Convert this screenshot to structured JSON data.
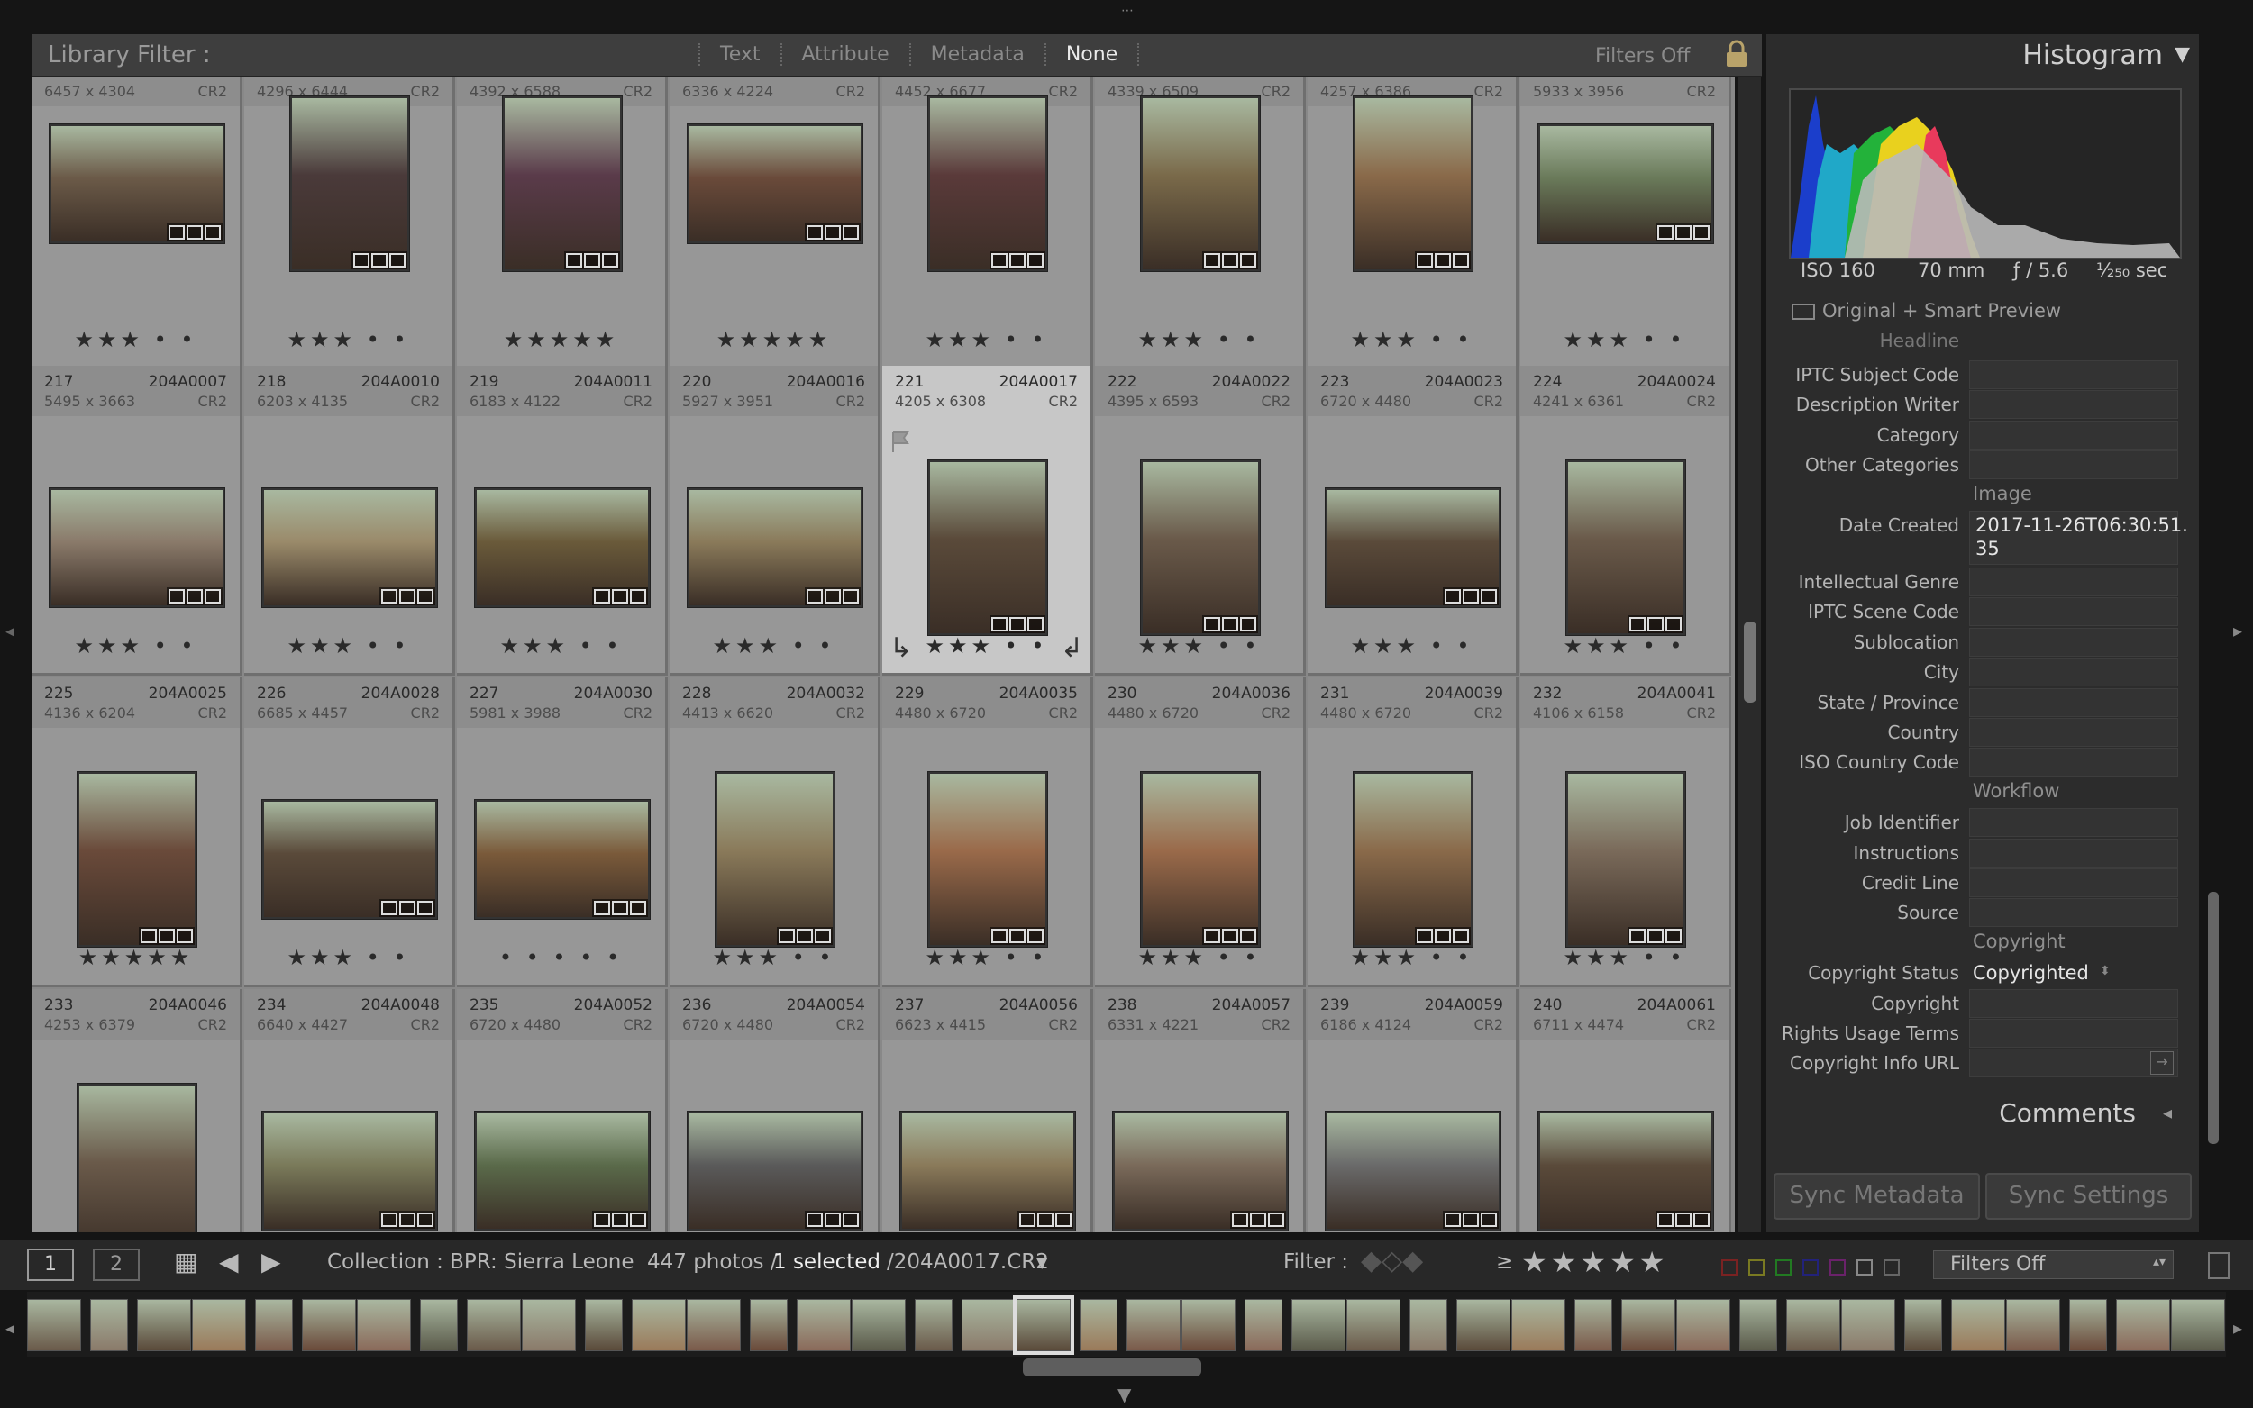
{
  "filter_bar": {
    "title": "Library Filter :",
    "tabs": [
      "Text",
      "Attribute",
      "Metadata",
      "None"
    ],
    "active_tab": "None",
    "filters_label": "Filters Off"
  },
  "grid": {
    "rows": [
      [
        {
          "dim": "6457 x 4304",
          "ext": "CR2",
          "stars": "★★★ • •"
        },
        {
          "dim": "4296 x 6444",
          "ext": "CR2",
          "stars": "★★★ • •"
        },
        {
          "dim": "4392 x 6588",
          "ext": "CR2",
          "stars": "★★★★★"
        },
        {
          "dim": "6336 x 4224",
          "ext": "CR2",
          "stars": "★★★★★"
        },
        {
          "dim": "4452 x 6677",
          "ext": "CR2",
          "stars": "★★★ • •"
        },
        {
          "dim": "4339 x 6509",
          "ext": "CR2",
          "stars": "★★★ • •"
        },
        {
          "dim": "4257 x 6386",
          "ext": "CR2",
          "stars": "★★★ • •"
        },
        {
          "dim": "5933 x 3956",
          "ext": "CR2",
          "stars": "★★★ • •"
        }
      ],
      [
        {
          "idx": "217",
          "code": "204A0007",
          "dim": "5495 x 3663",
          "ext": "CR2",
          "stars": "★★★ • •"
        },
        {
          "idx": "218",
          "code": "204A0010",
          "dim": "6203 x 4135",
          "ext": "CR2",
          "stars": "★★★ • •"
        },
        {
          "idx": "219",
          "code": "204A0011",
          "dim": "6183 x 4122",
          "ext": "CR2",
          "stars": "★★★ • •"
        },
        {
          "idx": "220",
          "code": "204A0016",
          "dim": "5927 x 3951",
          "ext": "CR2",
          "stars": "★★★ • •"
        },
        {
          "idx": "221",
          "code": "204A0017",
          "dim": "4205 x 6308",
          "ext": "CR2",
          "stars": "★★★ • •"
        },
        {
          "idx": "222",
          "code": "204A0022",
          "dim": "4395 x 6593",
          "ext": "CR2",
          "stars": "★★★ • •"
        },
        {
          "idx": "223",
          "code": "204A0023",
          "dim": "6720 x 4480",
          "ext": "CR2",
          "stars": "★★★ • •"
        },
        {
          "idx": "224",
          "code": "204A0024",
          "dim": "4241 x 6361",
          "ext": "CR2",
          "stars": "★★★ • •"
        }
      ],
      [
        {
          "idx": "225",
          "code": "204A0025",
          "dim": "4136 x 6204",
          "ext": "CR2",
          "stars": "★★★★★"
        },
        {
          "idx": "226",
          "code": "204A0028",
          "dim": "6685 x 4457",
          "ext": "CR2",
          "stars": "★★★ • •"
        },
        {
          "idx": "227",
          "code": "204A0030",
          "dim": "5981 x 3988",
          "ext": "CR2",
          "stars": "• • • • •"
        },
        {
          "idx": "228",
          "code": "204A0032",
          "dim": "4413 x 6620",
          "ext": "CR2",
          "stars": "★★★ • •"
        },
        {
          "idx": "229",
          "code": "204A0035",
          "dim": "4480 x 6720",
          "ext": "CR2",
          "stars": "★★★ • •"
        },
        {
          "idx": "230",
          "code": "204A0036",
          "dim": "4480 x 6720",
          "ext": "CR2",
          "stars": "★★★ • •"
        },
        {
          "idx": "231",
          "code": "204A0039",
          "dim": "4480 x 6720",
          "ext": "CR2",
          "stars": "★★★ • •"
        },
        {
          "idx": "232",
          "code": "204A0041",
          "dim": "4106 x 6158",
          "ext": "CR2",
          "stars": "★★★ • •"
        }
      ],
      [
        {
          "idx": "233",
          "code": "204A0046",
          "dim": "4253 x 6379",
          "ext": "CR2",
          "stars": ""
        },
        {
          "idx": "234",
          "code": "204A0048",
          "dim": "6640 x 4427",
          "ext": "CR2",
          "stars": ""
        },
        {
          "idx": "235",
          "code": "204A0052",
          "dim": "6720 x 4480",
          "ext": "CR2",
          "stars": ""
        },
        {
          "idx": "236",
          "code": "204A0054",
          "dim": "6720 x 4480",
          "ext": "CR2",
          "stars": ""
        },
        {
          "idx": "237",
          "code": "204A0056",
          "dim": "6623 x 4415",
          "ext": "CR2",
          "stars": ""
        },
        {
          "idx": "238",
          "code": "204A0057",
          "dim": "6331 x 4221",
          "ext": "CR2",
          "stars": ""
        },
        {
          "idx": "239",
          "code": "204A0059",
          "dim": "6186 x 4124",
          "ext": "CR2",
          "stars": ""
        },
        {
          "idx": "240",
          "code": "204A0061",
          "dim": "6711 x 4474",
          "ext": "CR2",
          "stars": ""
        }
      ]
    ]
  },
  "histogram": {
    "title": "Histogram",
    "iso": "ISO 160",
    "focal": "70 mm",
    "aperture": "ƒ / 5.6",
    "shutter": "¹⁄₂₅₀ sec",
    "preview": "Original + Smart Preview"
  },
  "metadata": {
    "partial_top": "Headline",
    "fields_a": [
      "IPTC Subject Code",
      "Description Writer",
      "Category",
      "Other Categories"
    ],
    "section_image": "Image",
    "date_label": "Date Created",
    "date_value_1": "2017-11-26T06:30:51.",
    "date_value_2": "35",
    "fields_b": [
      "Intellectual Genre",
      "IPTC Scene Code",
      "Sublocation",
      "City",
      "State / Province",
      "Country",
      "ISO Country Code"
    ],
    "section_workflow": "Workflow",
    "fields_c": [
      "Job Identifier",
      "Instructions",
      "Credit Line",
      "Source"
    ],
    "section_copyright": "Copyright",
    "copyright_status_label": "Copyright Status",
    "copyright_status_value": "Copyrighted",
    "fields_d": [
      "Copyright",
      "Rights Usage Terms",
      "Copyright Info URL"
    ]
  },
  "comments": {
    "title": "Comments"
  },
  "sync": {
    "metadata": "Sync Metadata",
    "settings": "Sync Settings"
  },
  "toolbar": {
    "page1": "1",
    "page2": "2",
    "collection": "Collection : BPR: Sierra Leone",
    "count": "447 photos /",
    "selected": "1 selected",
    "file": "/204A0017.CR2",
    "filter_label": "Filter :",
    "gte": "≥",
    "stars": "★★★★★",
    "filters_off": "Filters Off"
  }
}
